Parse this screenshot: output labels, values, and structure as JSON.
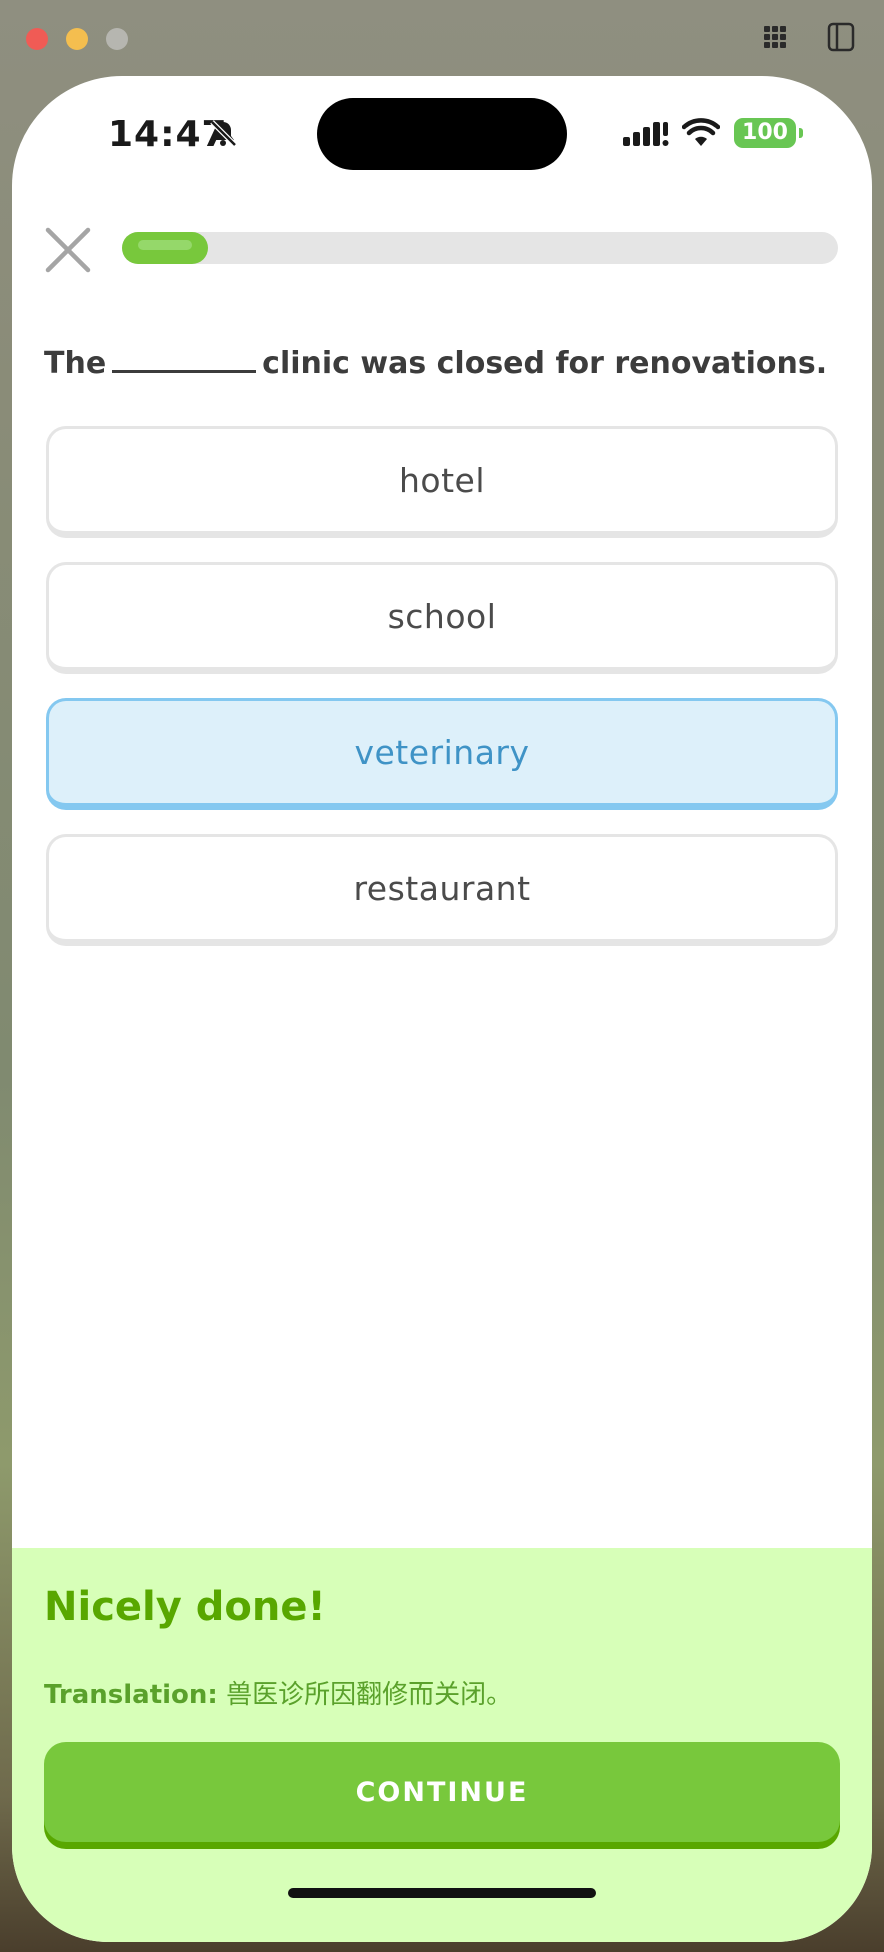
{
  "window": {
    "grid_icon": "grid-icon",
    "sidebar_icon": "sidebar-icon"
  },
  "status_bar": {
    "time": "14:47",
    "silent_icon": "bell-slash-icon",
    "battery": "100"
  },
  "lesson": {
    "progress": 0.12,
    "question_before": "The",
    "question_after": "clinic was closed for renovations.",
    "options": [
      {
        "label": "hotel",
        "selected": false
      },
      {
        "label": "school",
        "selected": false
      },
      {
        "label": "veterinary",
        "selected": true
      },
      {
        "label": "restaurant",
        "selected": false
      }
    ]
  },
  "feedback": {
    "title": "Nicely done!",
    "translation_label": "Translation:",
    "translation_text": "兽医诊所因翻修而关闭。",
    "continue_label": "CONTINUE"
  },
  "colors": {
    "brand_green": "#78c83c",
    "feedback_bg": "#d7ffb8",
    "selected_blue": "#ddf0fa"
  }
}
